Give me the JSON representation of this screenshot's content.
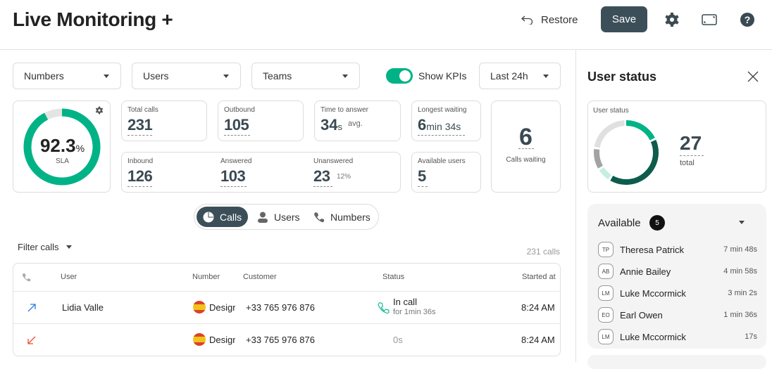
{
  "header": {
    "title": "Live Monitoring +",
    "restore_label": "Restore",
    "save_label": "Save"
  },
  "filters": {
    "numbers": "Numbers",
    "users": "Users",
    "teams": "Teams",
    "show_kpis": "Show KPIs",
    "show_kpis_on": true,
    "period": "Last 24h"
  },
  "sla": {
    "value": "92.3",
    "unit": "%",
    "label": "SLA",
    "percent": 92.3
  },
  "kpis": {
    "total_calls": {
      "label": "Total calls",
      "value": "231"
    },
    "outbound": {
      "label": "Outbound",
      "value": "105"
    },
    "time_to_answer": {
      "label": "Time to answer",
      "value": "34",
      "unit": "s",
      "suffix": "avg."
    },
    "longest_waiting": {
      "label": "Longest waiting",
      "value": "6",
      "rest": "min 34s"
    },
    "inbound": {
      "label": "Inbound",
      "value": "126"
    },
    "answered": {
      "label": "Answered",
      "value": "103"
    },
    "unanswered": {
      "label": "Unanswered",
      "value": "23",
      "pct": "12%"
    },
    "available_users": {
      "label": "Available users",
      "value": "5"
    },
    "calls_waiting": {
      "label": "Calls waiting",
      "value": "6"
    }
  },
  "view_tabs": [
    {
      "label": "Calls",
      "active": true
    },
    {
      "label": "Users"
    },
    {
      "label": "Numbers"
    }
  ],
  "calls": {
    "filter_label": "Filter calls",
    "count": "231 calls",
    "columns": [
      "User",
      "Number",
      "Customer",
      "Status",
      "Started at"
    ],
    "rows": [
      {
        "direction": "outbound",
        "user": "Lidia Valle",
        "number": "Design",
        "customer": "+33 765 976 876",
        "status": "In call",
        "status_sub": "for 1min 36s",
        "started": "8:24 AM"
      },
      {
        "direction": "inbound-missed",
        "user": "",
        "number": "Design",
        "customer": "+33 765 976 876",
        "status": "0s",
        "status_sub": "",
        "started": "8:24 AM"
      }
    ]
  },
  "user_status": {
    "title": "User status",
    "card_label": "User status",
    "total": "27",
    "total_label": "total",
    "segments": [
      {
        "value": 5,
        "color": "#00b386"
      },
      {
        "value": 11,
        "color": "#0d5c4c"
      },
      {
        "value": 2,
        "color": "#c6eee1"
      },
      {
        "value": 3,
        "color": "#a3a3a3"
      },
      {
        "value": 6,
        "color": "#e0e0e0"
      }
    ],
    "available": {
      "label": "Available",
      "count": "5",
      "users": [
        {
          "initials": "TP",
          "name": "Theresa Patrick",
          "time": "7 min 48s"
        },
        {
          "initials": "AB",
          "name": "Annie Bailey",
          "time": "4 min 58s"
        },
        {
          "initials": "LM",
          "name": "Luke Mccormick",
          "time": "3 min 2s"
        },
        {
          "initials": "EO",
          "name": "Earl Owen",
          "time": "1 min 36s"
        },
        {
          "initials": "LM",
          "name": "Luke Mccormick",
          "time": "17s"
        }
      ]
    }
  },
  "colors": {
    "accent": "#00b386",
    "primary": "#3c4f59"
  }
}
